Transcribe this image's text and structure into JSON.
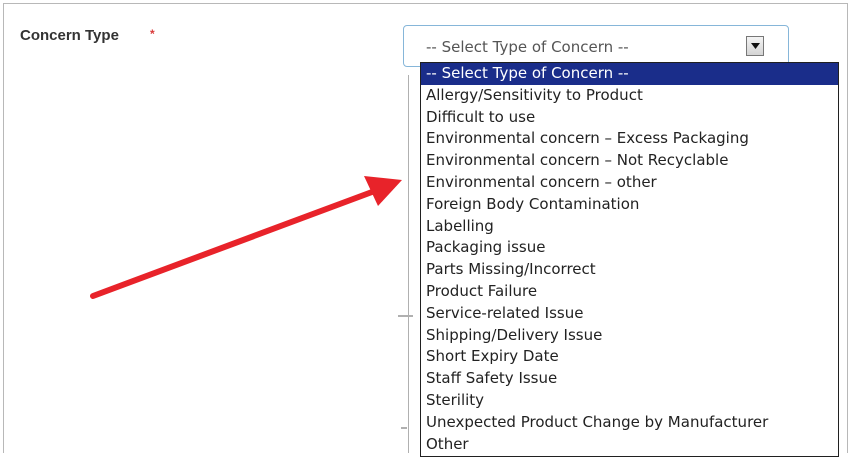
{
  "form": {
    "field_label": "Concern Type",
    "required_mark": "*",
    "select": {
      "value": "-- Select Type of Concern --",
      "options": [
        "-- Select Type of Concern --",
        "Allergy/Sensitivity to Product",
        "Difficult to use",
        "Environmental concern – Excess Packaging",
        "Environmental concern – Not Recyclable",
        "Environmental concern – other",
        "Foreign Body Contamination",
        "Labelling",
        "Packaging issue",
        "Parts Missing/Incorrect",
        "Product Failure",
        "Service-related Issue",
        "Shipping/Delivery Issue",
        "Short Expiry Date",
        "Staff Safety Issue",
        "Sterility",
        "Unexpected Product Change by Manufacturer",
        "Other"
      ],
      "highlighted_index": 0
    }
  },
  "annotation": {
    "arrow_color": "#e8232a"
  },
  "colors": {
    "highlight": "#1a2d8a",
    "focus_border": "#86b6d9",
    "required": "#d93a3a"
  },
  "icons": {
    "dropdown": "chevron-down-icon"
  }
}
